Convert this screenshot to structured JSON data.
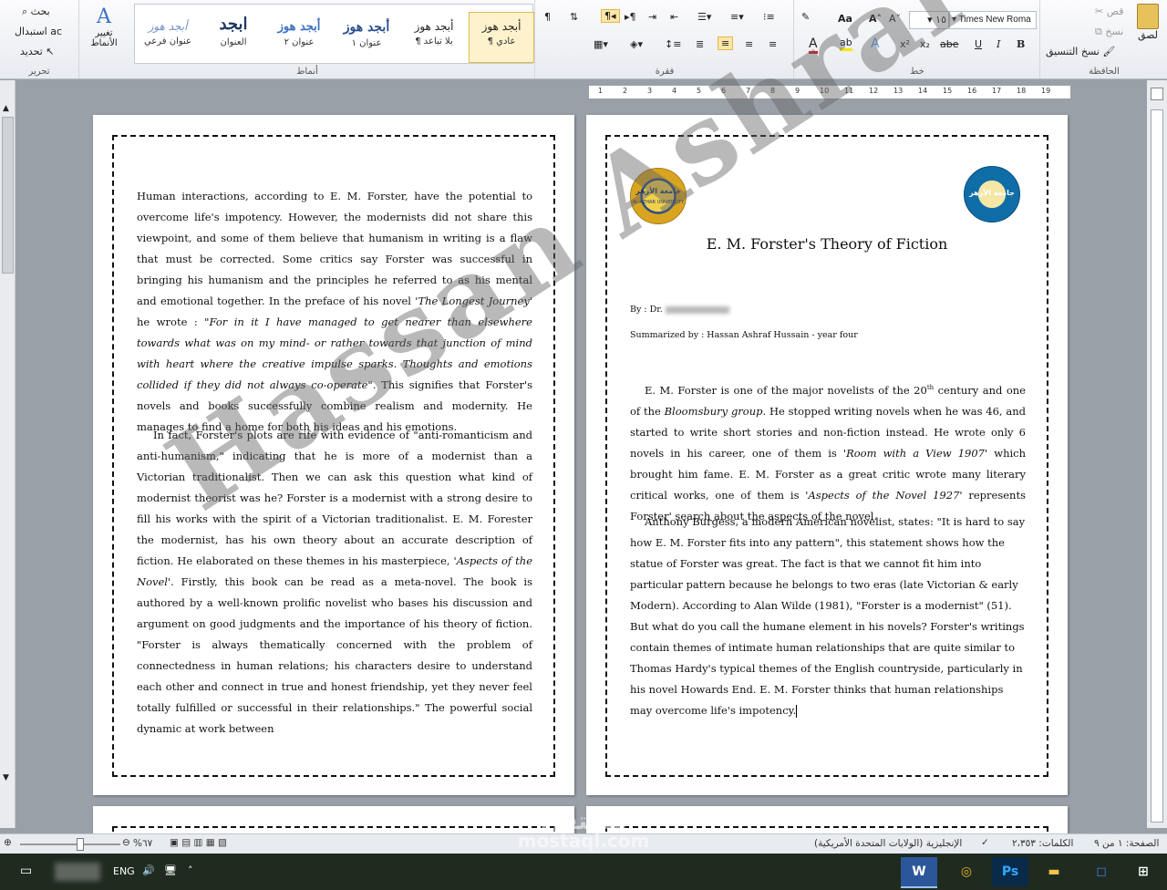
{
  "ribbon": {
    "clipboard": {
      "title": "الحافظة",
      "paste": "لصق",
      "cut": "قص",
      "copy": "نسخ",
      "format_painter": "نسخ التنسيق"
    },
    "font": {
      "title": "خط",
      "font_name": "Times New Roma",
      "font_size": "١٥",
      "bold": "B",
      "italic": "I",
      "underline": "U",
      "strike": "abe",
      "subscript": "x₂",
      "superscript": "x²",
      "grow": "A",
      "shrink": "A",
      "aa": "Aa"
    },
    "paragraph": {
      "title": "فقرة"
    },
    "styles": {
      "title": "أنماط",
      "items": [
        {
          "sample": "أبجد هوز",
          "name": "¶ عادي"
        },
        {
          "sample": "أبجد هوز",
          "name": "¶ بلا تباعد"
        },
        {
          "sample": "أبجد هوز",
          "name": "عنوان ١"
        },
        {
          "sample": "أبجد هوز",
          "name": "عنوان ٢"
        },
        {
          "sample": "ابجد",
          "name": "العنوان"
        },
        {
          "sample": "أبجد هوز",
          "name": "عنوان فرعي"
        }
      ],
      "change_styles": "تغيير الأنماط"
    },
    "editing": {
      "title": "تحرير",
      "find": "بحث",
      "replace": "استبدال",
      "select": "تحديد"
    }
  },
  "page_left": {
    "p1": {
      "a": "Human interactions, according to E. M. Forster, have the potential to overcome life's impotency. However, the modernists did not share this viewpoint, and some of them believe that humanism in writing is a flaw that must be corrected. Some critics say Forster was successful in bringing his humanism and the principles he referred to as his mental and emotional together. In the preface of his novel '",
      "i1": "The Longest Journey",
      "b": "' he wrote : \"",
      "i2": "For in it I have managed to get nearer than elsewhere towards what was on my mind- or rather towards that junction of mind with heart where the creative impulse sparks. Thoughts and emotions collided if they did not always co-operate",
      "c": "\". This signifies that Forster's novels and books successfully combine realism and modernity. He manages to find a home for both his ideas and his emotions."
    },
    "p2": {
      "a": "In fact, Forster's plots are rife with evidence of \"anti-romanticism and anti-humanism,\" indicating that he is more of a modernist than a Victorian traditionalist. Then we can ask this question what kind of modernist theorist was he? Forster is a modernist with a strong desire to fill his works with the spirit of a Victorian traditionalist. E. M. Forester the modernist, has his own theory about an accurate description of fiction. He elaborated on these themes in his masterpiece, '",
      "i1": "Aspects of the Novel",
      "b": "'. Firstly, this book can be read as a meta-novel. The book is authored by a well-known prolific novelist who bases his discussion and argument on good judgments and the importance of his theory of fiction. \"Forster is always thematically concerned with the problem of connectedness in human relations; his characters desire to understand each other and connect in true and honest friendship, yet they never feel totally fulfilled or successful in their relationships.\" The powerful social dynamic at work between"
    }
  },
  "page_right": {
    "title": "E. M. Forster's Theory of Fiction",
    "by": "By : Dr.",
    "summarized": "Summarized by : Hassan Ashraf Hussain - year four",
    "logo_left_text": "جامعة الأزهر",
    "logo_left_sub": "AL-AZHAR UNIVERSITY",
    "logo_right_text": "جامعة الأزهر",
    "p1": {
      "a": "E. M. Forster is one of the major novelists of the 20",
      "sup": "th",
      "b": " century and one of the ",
      "i1": "Bloomsbury group",
      "c": ". He stopped writing novels when he was 46, and started to write short stories and non-fiction instead. He wrote only 6 novels in his career, one of them is '",
      "i2": "Room with a View 1907",
      "d": "' which brought him fame. E. M. Forster as a great critic wrote many literary critical works, one of them is '",
      "i3": "Aspects of the Novel 1927",
      "e": "' represents Forster' search about the aspects of the novel."
    },
    "p2": "Anthony Burgess, a modern American novelist, states: \"It is hard to say how E. M. Forster fits into any pattern\", this statement shows how the statue of Forster was great. The fact is that we cannot fit him into particular pattern because he belongs to two eras (late Victorian & early Modern). According to Alan Wilde (1981), \"Forster is a modernist\" (51). But what do you call the humane element in his novels? Forster's writings contain themes of intimate human relationships that are quite similar to Thomas Hardy's typical themes of the English countryside, particularly in his novel Howards End. E. M. Forster thinks that human relationships may overcome life's impotency."
  },
  "watermark": "Hassan Ashraf",
  "ruler_numbers": [
    "1",
    "2",
    "3",
    "4",
    "5",
    "6",
    "7",
    "8",
    "9",
    "10",
    "11",
    "12",
    "13",
    "14",
    "15",
    "16",
    "17",
    "18",
    "19"
  ],
  "status": {
    "page": "الصفحة: ١ من ٩",
    "words": "الكلمات: ٢،٣٥٣",
    "language": "الإنجليزية (الولايات المتحدة الأمريكية)",
    "zoom": "%٦٧"
  },
  "taskbar": {
    "lang": "ENG"
  },
  "site_watermark": "mostaql.com",
  "site_watermark_ar": "مستقل"
}
